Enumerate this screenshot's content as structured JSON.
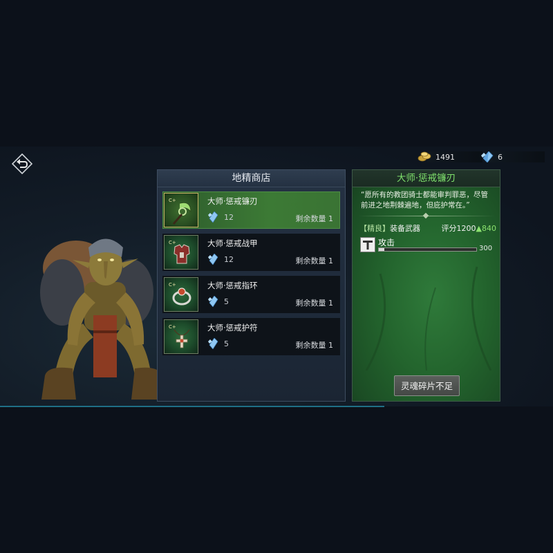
{
  "currency": {
    "gold": "1491",
    "crystal": "6"
  },
  "shop": {
    "title": "地精商店",
    "items": [
      {
        "name": "大师·惩戒镰刃",
        "cost": "12",
        "remaining": "剩余数量 1",
        "icon": "sickle-icon",
        "selected": true
      },
      {
        "name": "大师·惩戒战甲",
        "cost": "12",
        "remaining": "剩余数量 1",
        "icon": "armor-icon",
        "selected": false
      },
      {
        "name": "大师·惩戒指环",
        "cost": "5",
        "remaining": "剩余数量 1",
        "icon": "ring-icon",
        "selected": false
      },
      {
        "name": "大师·惩戒护符",
        "cost": "5",
        "remaining": "剩余数量 1",
        "icon": "amulet-icon",
        "selected": false
      }
    ]
  },
  "detail": {
    "title": "大师·惩戒镰刃",
    "description": "“愿所有的教团骑士都能审判罪恶，尽管前进之地荆棘遍地，但庇护常在。”",
    "quality": "【精良】",
    "type": "装备武器",
    "score_label": "评分1200",
    "score_up": "▲840",
    "stat_label": "攻击",
    "stat_value": "300",
    "stat_fill": 0.06,
    "button": "灵魂碎片不足"
  },
  "colors": {
    "accent_green": "#7fe16c",
    "selected_item": "#3c7a35",
    "panel_bg": "#1e2a3a"
  }
}
